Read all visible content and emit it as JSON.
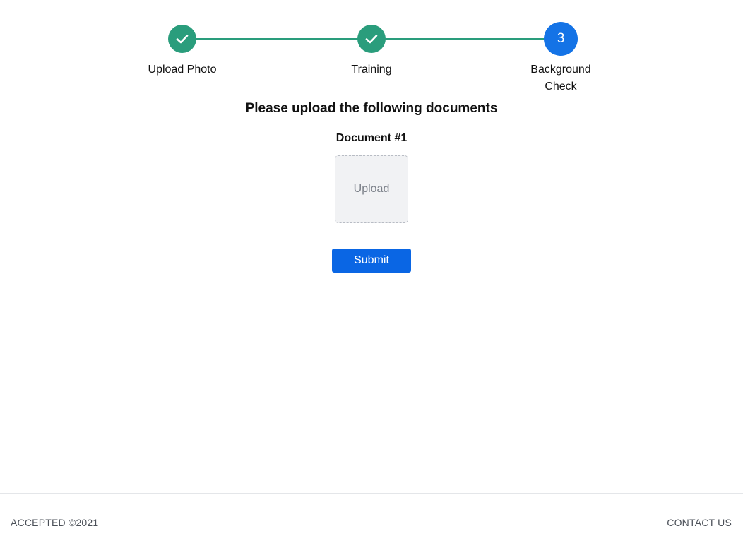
{
  "stepper": {
    "steps": [
      {
        "label": "Upload Photo",
        "status": "completed",
        "icon": "check-icon"
      },
      {
        "label": "Training",
        "status": "completed",
        "icon": "check-icon"
      },
      {
        "label": "Background Check",
        "status": "active",
        "number": "3"
      }
    ],
    "colors": {
      "completed": "#2a9d7c",
      "active": "#1473e6"
    }
  },
  "main": {
    "heading": "Please upload the following documents",
    "documents": [
      {
        "label": "Document #1",
        "upload_label": "Upload"
      }
    ],
    "submit_label": "Submit",
    "accent_color": "#0a66e4"
  },
  "footer": {
    "copyright": "ACCEPTED ©2021",
    "contact_label": "CONTACT US"
  }
}
